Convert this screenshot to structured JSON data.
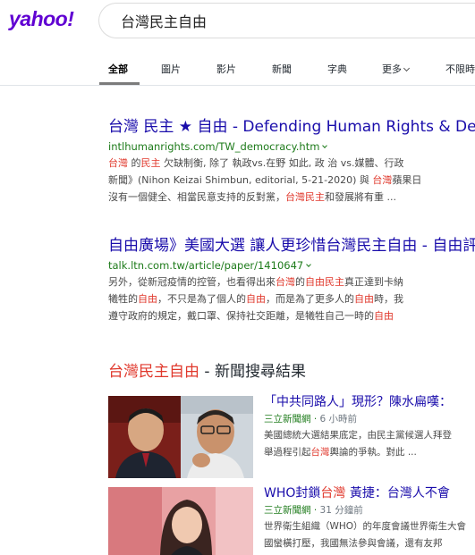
{
  "brand": {
    "logo": "yahoo!",
    "color": "#6001d2"
  },
  "search": {
    "value": "台灣民主自由"
  },
  "tabs": [
    {
      "label": "全部",
      "active": true
    },
    {
      "label": "圖片"
    },
    {
      "label": "影片"
    },
    {
      "label": "新聞"
    },
    {
      "label": "字典"
    },
    {
      "label": "更多"
    },
    {
      "label": "不限時"
    }
  ],
  "results": [
    {
      "title_parts": [
        "台灣 民主 ★ 自由 - Defending Human Rights & Democracy"
      ],
      "url": "intlhumanrights.com/TW_democracy.htm",
      "snippet_lines": [
        [
          [
            "hl",
            "台灣"
          ],
          [
            "t",
            " 的"
          ],
          [
            "hl",
            "民主"
          ],
          [
            "t",
            " 欠缺制衡, 除了 執政vs.在野 如此, 政 治 vs.媒體、行政"
          ]
        ],
        [
          [
            "t",
            "新聞》(Nihon Keizai Shimbun, editorial, 5-21-2020) 與 "
          ],
          [
            "hl",
            "台灣"
          ],
          [
            "t",
            "蘋果日"
          ]
        ],
        [
          [
            "t",
            "沒有一個健全、相當民意支持的反對黨，"
          ],
          [
            "hl",
            "台灣民主"
          ],
          [
            "t",
            "和發展將有重 ..."
          ]
        ]
      ]
    },
    {
      "title_parts": [
        "自由廣場》美國大選 讓人更珍惜台灣民主自由 - 自由評論網"
      ],
      "url": "talk.ltn.com.tw/article/paper/1410647",
      "snippet_lines": [
        [
          [
            "t",
            "另外，從新冠疫情的控管，也看得出來"
          ],
          [
            "hl",
            "台灣"
          ],
          [
            "t",
            "的"
          ],
          [
            "hl",
            "自由民主"
          ],
          [
            "t",
            "真正達到卡納"
          ]
        ],
        [
          [
            "t",
            "犧牲的"
          ],
          [
            "hl",
            "自由"
          ],
          [
            "t",
            "，不只是為了個人的"
          ],
          [
            "hl",
            "自由"
          ],
          [
            "t",
            "，而是為了更多人的"
          ],
          [
            "hl",
            "自由"
          ],
          [
            "t",
            "時，我"
          ]
        ],
        [
          [
            "t",
            "遵守政府的規定，戴口罩、保持社交距離，是犧牲自己一時的"
          ],
          [
            "hl",
            "自由"
          ]
        ]
      ]
    }
  ],
  "news": {
    "header_highlight": "台灣民主自由",
    "header_suffix": " - 新聞搜尋結果",
    "items": [
      {
        "title": "「中共同路人」現形？陳水扁嘆：",
        "source": "三立新聞網",
        "time": "6 小時前",
        "snippet_lines": [
          [
            [
              "t",
              "美國總統大選結果底定，由民主黨候選人拜登"
            ]
          ],
          [
            [
              "t",
              "舉過程引起"
            ],
            [
              "hl",
              "台灣"
            ],
            [
              "t",
              "輿論的爭執。對此 ..."
            ]
          ]
        ]
      },
      {
        "title_parts": [
          [
            "t",
            "WHO封鎖"
          ],
          [
            "hl",
            "台灣"
          ],
          [
            "t",
            " 黃捷：台灣人不會"
          ]
        ],
        "source": "三立新聞網",
        "time": "31 分鐘前",
        "snippet_lines": [
          [
            [
              "t",
              "世界衛生組織（WHO）的年度會議世界衛生大會"
            ]
          ],
          [
            [
              "t",
              "國蠻橫打壓，我國無法參與會議，還有友邦"
            ]
          ]
        ]
      }
    ]
  }
}
